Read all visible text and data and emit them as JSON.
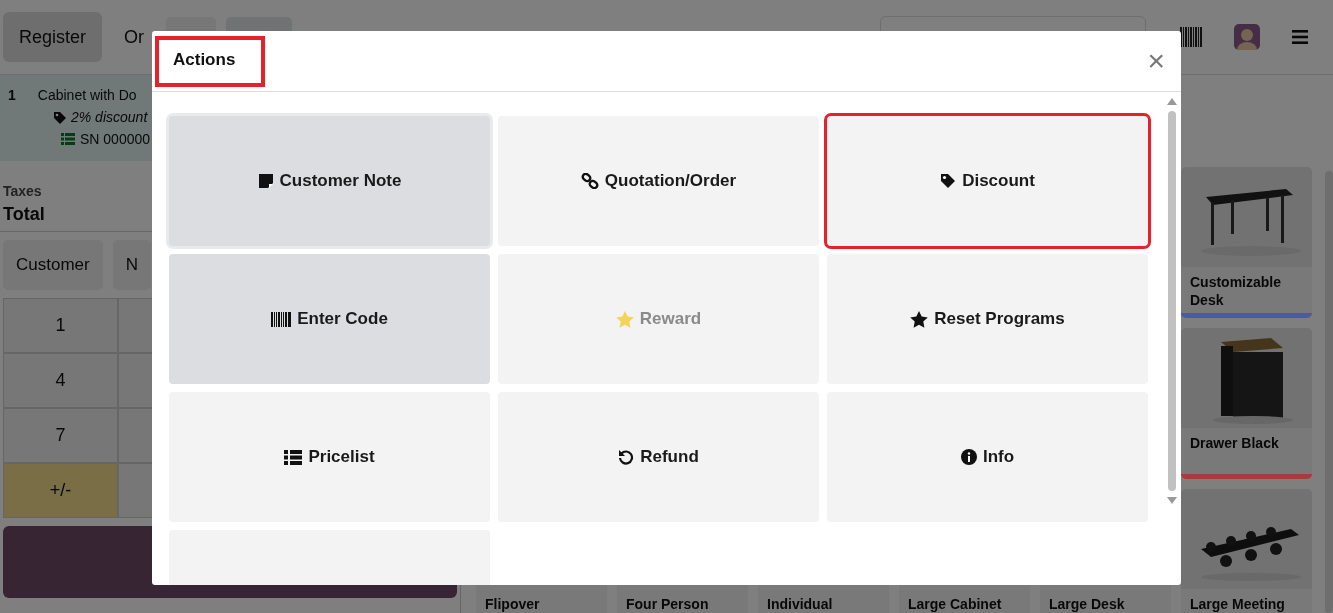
{
  "topbar": {
    "buttons": [
      {
        "label": "Register",
        "selected": true
      },
      {
        "label": "Or",
        "selected": false
      }
    ]
  },
  "order": {
    "lines": [
      {
        "qty": "1",
        "name": "Cabinet with Do",
        "discount": "2% discount",
        "serial": "SN 000000"
      }
    ],
    "taxes_label": "Taxes",
    "total_label": "Total"
  },
  "controls": {
    "buttons": [
      "Customer",
      "N"
    ],
    "numpad": [
      {
        "label": "1",
        "selected": false
      },
      {
        "label": "4",
        "selected": false
      },
      {
        "label": "7",
        "selected": false
      },
      {
        "label": "+/-",
        "selected": true
      }
    ]
  },
  "products": {
    "right_column": [
      {
        "name": "Customizable Desk",
        "color": "#4a5aa5",
        "picture": true
      },
      {
        "name": "Drawer Black",
        "color": "#a83c3c",
        "picture": true
      }
    ],
    "bottom_row": [
      {
        "name": "Flipover",
        "picture": false
      },
      {
        "name": "Four Person",
        "picture": false
      },
      {
        "name": "Individual",
        "picture": false
      },
      {
        "name": "Large Cabinet",
        "picture": false
      },
      {
        "name": "Large Desk",
        "picture": false
      },
      {
        "name": "Large Meeting",
        "picture": true
      }
    ]
  },
  "dialog": {
    "title": "Actions",
    "title_annotated": true,
    "close": "×",
    "actions": [
      {
        "label": "Customer Note",
        "kind": "note",
        "highlighted": true,
        "focused": true,
        "disabled": false,
        "annotated": false
      },
      {
        "label": "Quotation/Order",
        "kind": "link",
        "highlighted": false,
        "focused": false,
        "disabled": false,
        "annotated": false
      },
      {
        "label": "Discount",
        "kind": "tag",
        "highlighted": false,
        "focused": false,
        "disabled": false,
        "annotated": true
      },
      {
        "label": "Enter Code",
        "kind": "barcode",
        "highlighted": true,
        "focused": false,
        "disabled": false,
        "annotated": false
      },
      {
        "label": "Reward",
        "kind": "reward",
        "highlighted": false,
        "focused": false,
        "disabled": true,
        "annotated": false
      },
      {
        "label": "Reset Programs",
        "kind": "star",
        "highlighted": false,
        "focused": false,
        "disabled": false,
        "annotated": false
      },
      {
        "label": "Pricelist",
        "kind": "list",
        "highlighted": false,
        "focused": false,
        "disabled": false,
        "annotated": false
      },
      {
        "label": "Refund",
        "kind": "undo",
        "highlighted": false,
        "focused": false,
        "disabled": false,
        "annotated": false
      },
      {
        "label": "Info",
        "kind": "info",
        "highlighted": false,
        "focused": false,
        "disabled": false,
        "annotated": false
      }
    ]
  }
}
